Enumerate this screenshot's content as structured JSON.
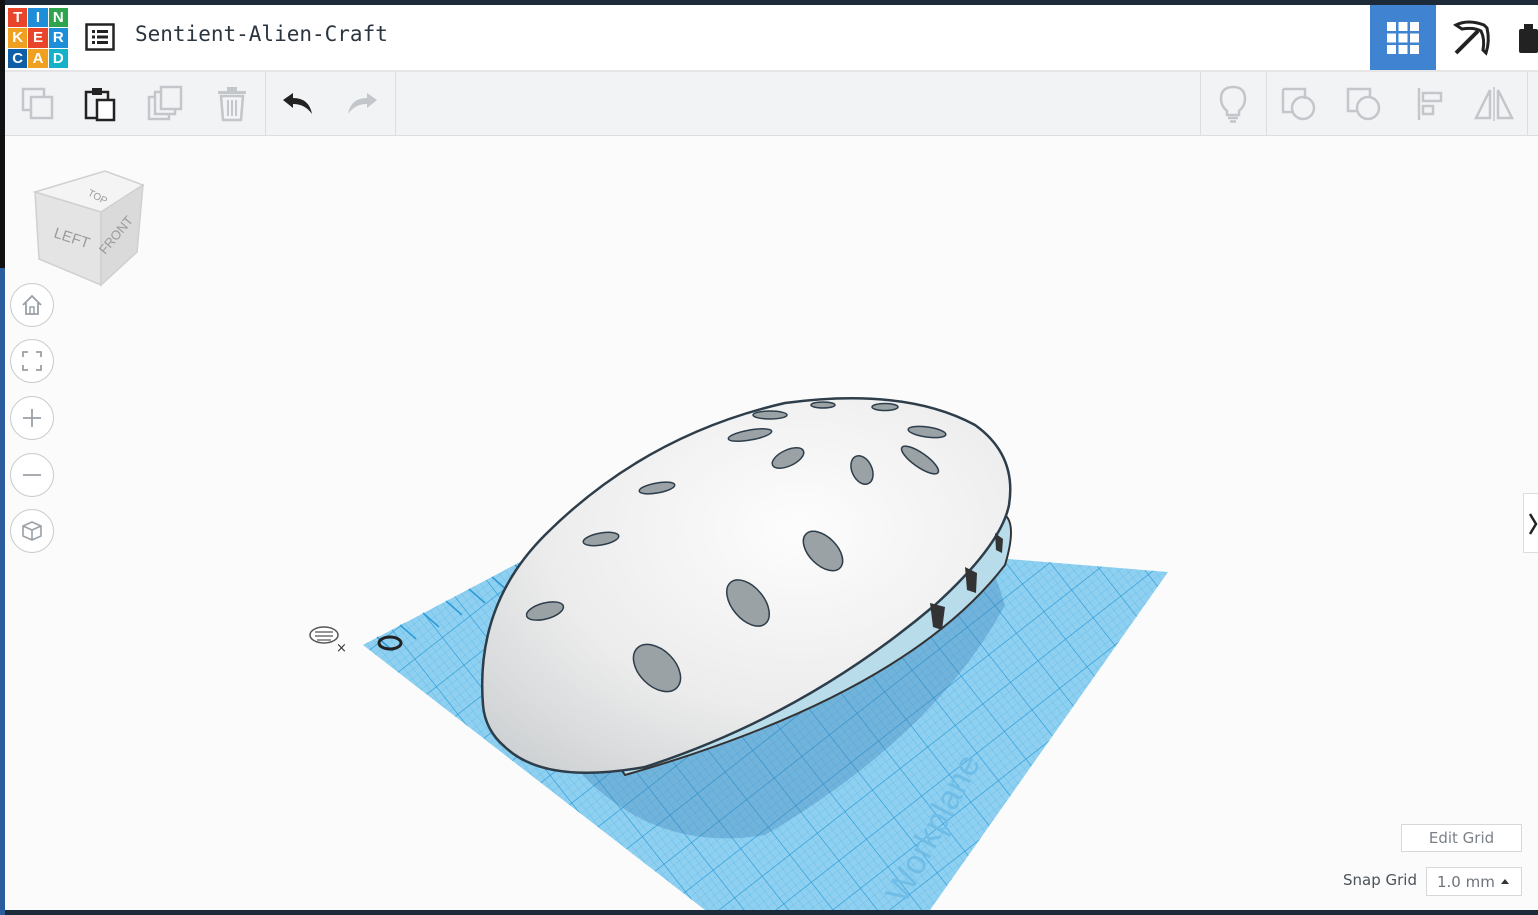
{
  "app": {
    "logo_letters": [
      "T",
      "I",
      "N",
      "K",
      "E",
      "R",
      "C",
      "A",
      "D"
    ],
    "design_title": "Sentient-Alien-Craft"
  },
  "toolbar": {
    "copy": "copy-icon",
    "paste": "paste-icon",
    "duplicate": "duplicate-icon",
    "delete": "trash-icon",
    "undo": "undo-icon",
    "redo": "redo-icon",
    "notes": "lightbulb-icon",
    "shape": "shape-icon",
    "hole": "hole-icon",
    "align": "align-icon",
    "mirror": "mirror-icon"
  },
  "viewcube": {
    "top": "TOP",
    "left": "LEFT",
    "front": "FRONT"
  },
  "workplane": {
    "label": "Workplane"
  },
  "footer": {
    "edit_grid": "Edit Grid",
    "snap_grid_label": "Snap Grid",
    "snap_grid_value": "1.0 mm"
  },
  "colors": {
    "accent": "#3f83d1",
    "workplane": "#7cc6ec",
    "grid_line": "#2a9ad8"
  }
}
